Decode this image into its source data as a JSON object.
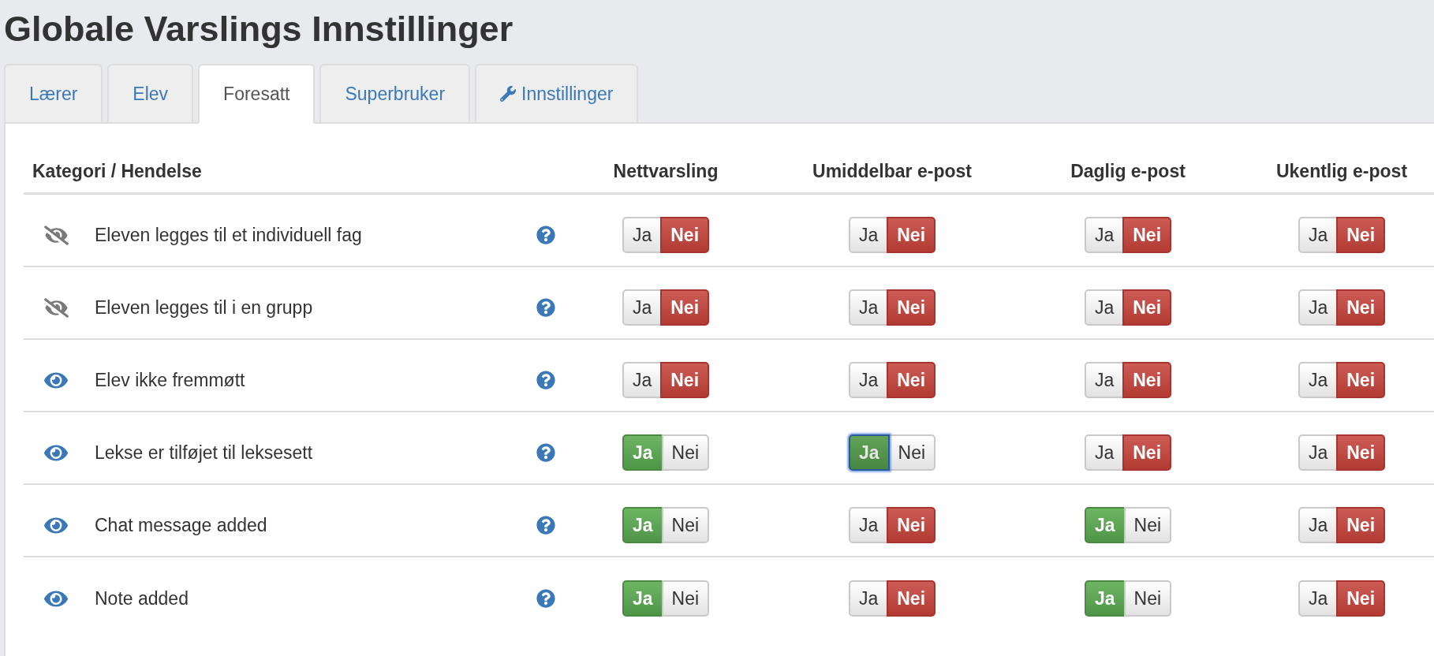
{
  "title": "Globale Varslings Innstillinger",
  "tabs": [
    {
      "label": "Lærer",
      "selected": false,
      "kind": "plain"
    },
    {
      "label": "Elev",
      "selected": false,
      "kind": "plain"
    },
    {
      "label": "Foresatt",
      "selected": true,
      "kind": "plain"
    },
    {
      "label": "Superbruker",
      "selected": false,
      "kind": "plain"
    },
    {
      "label": "Innstillinger",
      "selected": false,
      "kind": "settings"
    }
  ],
  "table": {
    "columns": [
      "Kategori / Hendelse",
      "Nettvarsling",
      "Umiddelbar e-post",
      "Daglig e-post",
      "Ukentlig e-post"
    ],
    "rows": [
      {
        "visible": false,
        "label": "Eleven legges til et individuell fag",
        "toggles": [
          {
            "options": [
              {
                "label": "Ja",
                "selected": false,
                "focused": false
              },
              {
                "label": "Nei",
                "selected": true,
                "focused": false
              }
            ]
          },
          {
            "options": [
              {
                "label": "Ja",
                "selected": false,
                "focused": false
              },
              {
                "label": "Nei",
                "selected": true,
                "focused": false
              }
            ]
          },
          {
            "options": [
              {
                "label": "Ja",
                "selected": false,
                "focused": false
              },
              {
                "label": "Nei",
                "selected": true,
                "focused": false
              }
            ]
          },
          {
            "options": [
              {
                "label": "Ja",
                "selected": false,
                "focused": false
              },
              {
                "label": "Nei",
                "selected": true,
                "focused": false
              }
            ]
          }
        ]
      },
      {
        "visible": false,
        "label": "Eleven legges til i en grupp",
        "toggles": [
          {
            "options": [
              {
                "label": "Ja",
                "selected": false,
                "focused": false
              },
              {
                "label": "Nei",
                "selected": true,
                "focused": false
              }
            ]
          },
          {
            "options": [
              {
                "label": "Ja",
                "selected": false,
                "focused": false
              },
              {
                "label": "Nei",
                "selected": true,
                "focused": false
              }
            ]
          },
          {
            "options": [
              {
                "label": "Ja",
                "selected": false,
                "focused": false
              },
              {
                "label": "Nei",
                "selected": true,
                "focused": false
              }
            ]
          },
          {
            "options": [
              {
                "label": "Ja",
                "selected": false,
                "focused": false
              },
              {
                "label": "Nei",
                "selected": true,
                "focused": false
              }
            ]
          }
        ]
      },
      {
        "visible": true,
        "label": "Elev ikke fremmøtt",
        "toggles": [
          {
            "options": [
              {
                "label": "Ja",
                "selected": false,
                "focused": false
              },
              {
                "label": "Nei",
                "selected": true,
                "focused": false
              }
            ]
          },
          {
            "options": [
              {
                "label": "Ja",
                "selected": false,
                "focused": false
              },
              {
                "label": "Nei",
                "selected": true,
                "focused": false
              }
            ]
          },
          {
            "options": [
              {
                "label": "Ja",
                "selected": false,
                "focused": false
              },
              {
                "label": "Nei",
                "selected": true,
                "focused": false
              }
            ]
          },
          {
            "options": [
              {
                "label": "Ja",
                "selected": false,
                "focused": false
              },
              {
                "label": "Nei",
                "selected": true,
                "focused": false
              }
            ]
          }
        ]
      },
      {
        "visible": true,
        "label": "Lekse er tilføjet til leksesett",
        "toggles": [
          {
            "options": [
              {
                "label": "Ja",
                "selected": true,
                "focused": false
              },
              {
                "label": "Nei",
                "selected": false,
                "focused": false
              }
            ]
          },
          {
            "options": [
              {
                "label": "Ja",
                "selected": true,
                "focused": true
              },
              {
                "label": "Nei",
                "selected": false,
                "focused": false
              }
            ]
          },
          {
            "options": [
              {
                "label": "Ja",
                "selected": false,
                "focused": false
              },
              {
                "label": "Nei",
                "selected": true,
                "focused": false
              }
            ]
          },
          {
            "options": [
              {
                "label": "Ja",
                "selected": false,
                "focused": false
              },
              {
                "label": "Nei",
                "selected": true,
                "focused": false
              }
            ]
          }
        ]
      },
      {
        "visible": true,
        "label": "Chat message added",
        "toggles": [
          {
            "options": [
              {
                "label": "Ja",
                "selected": true,
                "focused": false
              },
              {
                "label": "Nei",
                "selected": false,
                "focused": false
              }
            ]
          },
          {
            "options": [
              {
                "label": "Ja",
                "selected": false,
                "focused": false
              },
              {
                "label": "Nei",
                "selected": true,
                "focused": false
              }
            ]
          },
          {
            "options": [
              {
                "label": "Ja",
                "selected": true,
                "focused": false
              },
              {
                "label": "Nei",
                "selected": false,
                "focused": false
              }
            ]
          },
          {
            "options": [
              {
                "label": "Ja",
                "selected": false,
                "focused": false
              },
              {
                "label": "Nei",
                "selected": true,
                "focused": false
              }
            ]
          }
        ]
      },
      {
        "visible": true,
        "label": "Note added",
        "toggles": [
          {
            "options": [
              {
                "label": "Ja",
                "selected": true,
                "focused": false
              },
              {
                "label": "Nei",
                "selected": false,
                "focused": false
              }
            ]
          },
          {
            "options": [
              {
                "label": "Ja",
                "selected": false,
                "focused": false
              },
              {
                "label": "Nei",
                "selected": true,
                "focused": false
              }
            ]
          },
          {
            "options": [
              {
                "label": "Ja",
                "selected": true,
                "focused": false
              },
              {
                "label": "Nei",
                "selected": false,
                "focused": false
              }
            ]
          },
          {
            "options": [
              {
                "label": "Ja",
                "selected": false,
                "focused": false
              },
              {
                "label": "Nei",
                "selected": true,
                "focused": false
              }
            ]
          }
        ]
      }
    ]
  }
}
